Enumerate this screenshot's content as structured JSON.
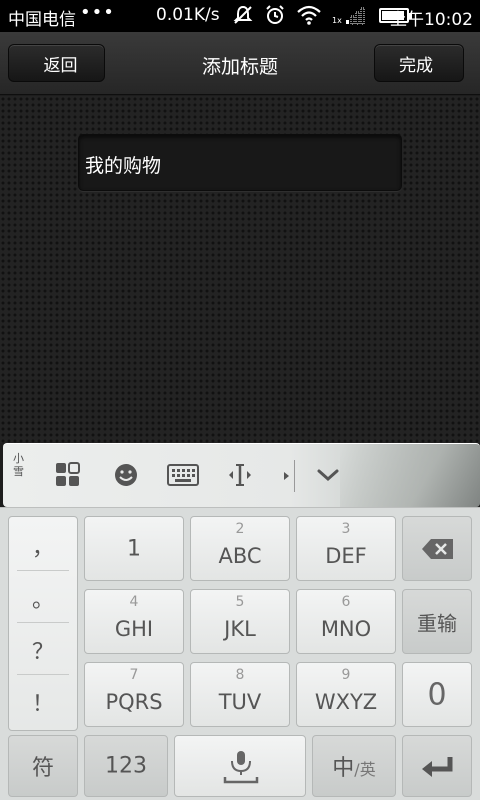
{
  "status_bar": {
    "carrier": "中国电信",
    "dots": "•••",
    "speed": "0.01K/s",
    "time": "上午10:02",
    "icons": [
      "muted-icon",
      "alarm-icon",
      "wifi-icon",
      "signal-icon",
      "battery-icon"
    ],
    "signal_label": "1x"
  },
  "header": {
    "back_label": "返回",
    "title": "添加标题",
    "done_label": "完成"
  },
  "editor": {
    "input_value": "我的购物"
  },
  "ime_toolbar": {
    "logo_text": "小\n雪",
    "icons": [
      "grid-icon",
      "emoji-icon",
      "keyboard-icon",
      "cursor-move-icon",
      "arrow-icon",
      "collapse-icon"
    ]
  },
  "keyboard": {
    "punctuation": [
      "，",
      "。",
      "？",
      "！"
    ],
    "row1": [
      {
        "num": "",
        "label": "1"
      },
      {
        "num": "2",
        "label": "ABC"
      },
      {
        "num": "3",
        "label": "DEF"
      }
    ],
    "row2": [
      {
        "num": "4",
        "label": "GHI"
      },
      {
        "num": "5",
        "label": "JKL"
      },
      {
        "num": "6",
        "label": "MNO"
      }
    ],
    "row3": [
      {
        "num": "7",
        "label": "PQRS"
      },
      {
        "num": "8",
        "label": "TUV"
      },
      {
        "num": "9",
        "label": "WXYZ"
      }
    ],
    "retype_label": "重输",
    "zero_label": "0",
    "symbol_label": "符",
    "numeric_label": "123",
    "lang_label_main": "中",
    "lang_label_sub": "/英"
  },
  "colors": {
    "header_bg": "#2e2e2e",
    "content_bg": "#232323",
    "keyboard_bg": "#d9dcdb",
    "key_text": "#555555"
  }
}
